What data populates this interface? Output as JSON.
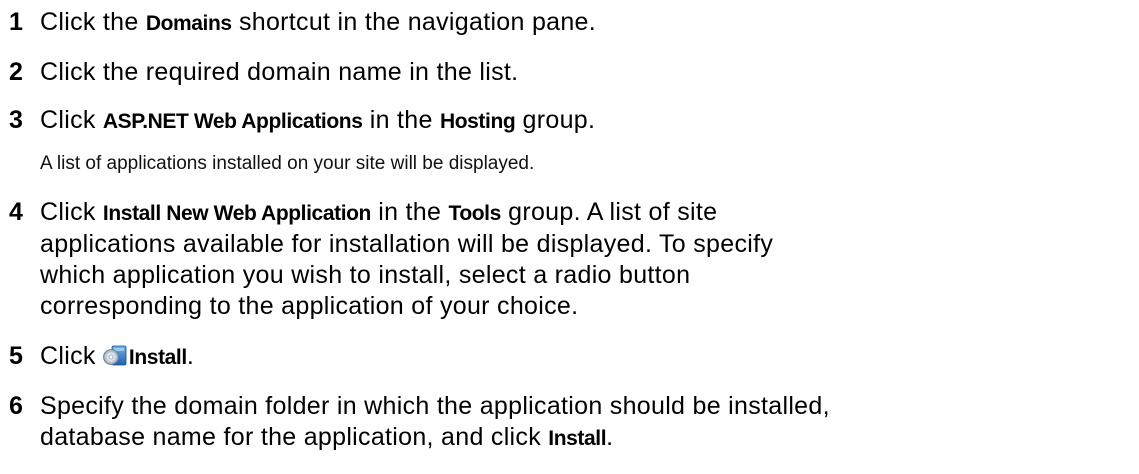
{
  "steps": [
    {
      "number": "1",
      "parts": [
        "Click the ",
        "Domains",
        " shortcut in the navigation pane."
      ]
    },
    {
      "number": "2",
      "text": "Click the required domain name in the list."
    },
    {
      "number": "3",
      "parts": [
        "Click ",
        "ASP.NET Web Applications",
        " in the ",
        "Hosting",
        " group."
      ],
      "note": "A list of applications installed on your site will be displayed."
    },
    {
      "number": "4",
      "parts": [
        "Click ",
        "Install New Web Application",
        " in the ",
        "Tools",
        " group. A list of site"
      ],
      "lines": [
        "applications available for installation will be displayed. To specify",
        "which application you wish to install, select a radio button",
        "corresponding to the application of your choice."
      ]
    },
    {
      "number": "5",
      "parts": [
        "Click ",
        "Install",
        "."
      ],
      "icon": "install-icon"
    },
    {
      "number": "6",
      "line1": "Specify the domain folder in which the application should be installed,",
      "parts": [
        "database name for the application, and click ",
        "Install",
        "."
      ]
    }
  ]
}
